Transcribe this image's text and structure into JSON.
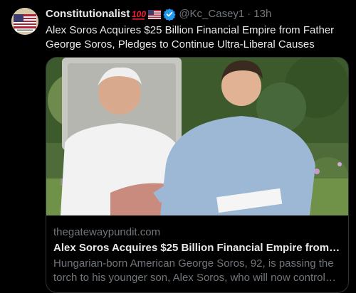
{
  "author": {
    "display_name": "Constitutionalist",
    "handle": "@Kc_Casey1",
    "time": "13h",
    "avatar_icon": "flag-avatar-icon",
    "badges": [
      "hundred-points-icon",
      "us-flag-icon",
      "verified-badge-icon"
    ]
  },
  "tweet": {
    "text": "Alex Soros Acquires $25 Billion Financial Empire from Father George Soros, Pledges to Continue Ultra-Liberal Causes"
  },
  "card": {
    "domain": "thegatewaypundit.com",
    "title": "Alex Soros Acquires $25 Billion Financial Empire from Fathe...",
    "description": "Hungarian-born American George Soros, 92, is passing the torch to his younger son, Alex Soros, who will now control hi..."
  },
  "colors": {
    "background": "#000000",
    "primary_text": "#e7e9ea",
    "secondary_text": "#71767b",
    "verified_blue": "#1d9bf0",
    "border": "#2f3336"
  }
}
